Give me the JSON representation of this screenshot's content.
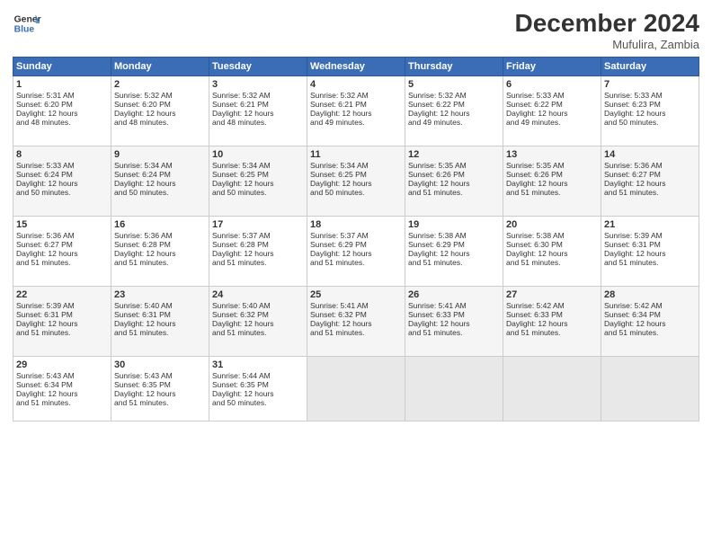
{
  "header": {
    "logo_line1": "General",
    "logo_line2": "Blue",
    "title": "December 2024",
    "location": "Mufulira, Zambia"
  },
  "days_of_week": [
    "Sunday",
    "Monday",
    "Tuesday",
    "Wednesday",
    "Thursday",
    "Friday",
    "Saturday"
  ],
  "weeks": [
    [
      {
        "day": 1,
        "rise": "5:31 AM",
        "set": "6:20 PM",
        "hours": "12",
        "mins": "48"
      },
      {
        "day": 2,
        "rise": "5:32 AM",
        "set": "6:20 PM",
        "hours": "12",
        "mins": "48"
      },
      {
        "day": 3,
        "rise": "5:32 AM",
        "set": "6:21 PM",
        "hours": "12",
        "mins": "48"
      },
      {
        "day": 4,
        "rise": "5:32 AM",
        "set": "6:21 PM",
        "hours": "12",
        "mins": "49"
      },
      {
        "day": 5,
        "rise": "5:32 AM",
        "set": "6:22 PM",
        "hours": "12",
        "mins": "49"
      },
      {
        "day": 6,
        "rise": "5:33 AM",
        "set": "6:22 PM",
        "hours": "12",
        "mins": "49"
      },
      {
        "day": 7,
        "rise": "5:33 AM",
        "set": "6:23 PM",
        "hours": "12",
        "mins": "50"
      }
    ],
    [
      {
        "day": 8,
        "rise": "5:33 AM",
        "set": "6:24 PM",
        "hours": "12",
        "mins": "50"
      },
      {
        "day": 9,
        "rise": "5:34 AM",
        "set": "6:24 PM",
        "hours": "12",
        "mins": "50"
      },
      {
        "day": 10,
        "rise": "5:34 AM",
        "set": "6:25 PM",
        "hours": "12",
        "mins": "50"
      },
      {
        "day": 11,
        "rise": "5:34 AM",
        "set": "6:25 PM",
        "hours": "12",
        "mins": "50"
      },
      {
        "day": 12,
        "rise": "5:35 AM",
        "set": "6:26 PM",
        "hours": "12",
        "mins": "51"
      },
      {
        "day": 13,
        "rise": "5:35 AM",
        "set": "6:26 PM",
        "hours": "12",
        "mins": "51"
      },
      {
        "day": 14,
        "rise": "5:36 AM",
        "set": "6:27 PM",
        "hours": "12",
        "mins": "51"
      }
    ],
    [
      {
        "day": 15,
        "rise": "5:36 AM",
        "set": "6:27 PM",
        "hours": "12",
        "mins": "51"
      },
      {
        "day": 16,
        "rise": "5:36 AM",
        "set": "6:28 PM",
        "hours": "12",
        "mins": "51"
      },
      {
        "day": 17,
        "rise": "5:37 AM",
        "set": "6:28 PM",
        "hours": "12",
        "mins": "51"
      },
      {
        "day": 18,
        "rise": "5:37 AM",
        "set": "6:29 PM",
        "hours": "12",
        "mins": "51"
      },
      {
        "day": 19,
        "rise": "5:38 AM",
        "set": "6:29 PM",
        "hours": "12",
        "mins": "51"
      },
      {
        "day": 20,
        "rise": "5:38 AM",
        "set": "6:30 PM",
        "hours": "12",
        "mins": "51"
      },
      {
        "day": 21,
        "rise": "5:39 AM",
        "set": "6:31 PM",
        "hours": "12",
        "mins": "51"
      }
    ],
    [
      {
        "day": 22,
        "rise": "5:39 AM",
        "set": "6:31 PM",
        "hours": "12",
        "mins": "51"
      },
      {
        "day": 23,
        "rise": "5:40 AM",
        "set": "6:31 PM",
        "hours": "12",
        "mins": "51"
      },
      {
        "day": 24,
        "rise": "5:40 AM",
        "set": "6:32 PM",
        "hours": "12",
        "mins": "51"
      },
      {
        "day": 25,
        "rise": "5:41 AM",
        "set": "6:32 PM",
        "hours": "12",
        "mins": "51"
      },
      {
        "day": 26,
        "rise": "5:41 AM",
        "set": "6:33 PM",
        "hours": "12",
        "mins": "51"
      },
      {
        "day": 27,
        "rise": "5:42 AM",
        "set": "6:33 PM",
        "hours": "12",
        "mins": "51"
      },
      {
        "day": 28,
        "rise": "5:42 AM",
        "set": "6:34 PM",
        "hours": "12",
        "mins": "51"
      }
    ],
    [
      {
        "day": 29,
        "rise": "5:43 AM",
        "set": "6:34 PM",
        "hours": "12",
        "mins": "51"
      },
      {
        "day": 30,
        "rise": "5:43 AM",
        "set": "6:35 PM",
        "hours": "12",
        "mins": "51"
      },
      {
        "day": 31,
        "rise": "5:44 AM",
        "set": "6:35 PM",
        "hours": "12",
        "mins": "50"
      },
      null,
      null,
      null,
      null
    ]
  ]
}
